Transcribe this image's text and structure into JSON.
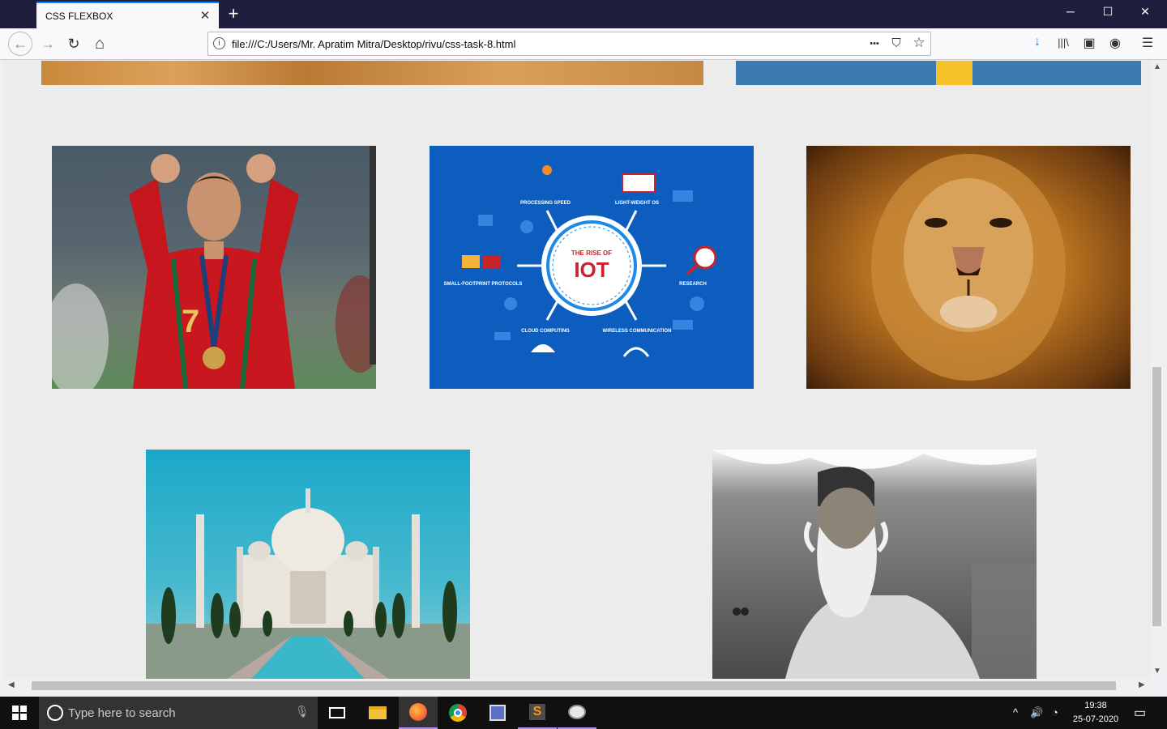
{
  "tab": {
    "title": "CSS FLEXBOX",
    "close": "✕",
    "new_tab": "+"
  },
  "window_controls": {
    "minimize": "─",
    "maximize": "☐",
    "close": "✕"
  },
  "nav": {
    "url": "file:///C:/Users/Mr. Apratim Mitra/Desktop/rivu/css-task-8.html",
    "back": "←",
    "forward": "→",
    "reload": "↻",
    "home": "⌂",
    "page_actions": "•••",
    "pocket": "⛉",
    "star": "☆",
    "download": "↓",
    "library": "|||\\",
    "sidebar": "▣",
    "account": "◉",
    "menu": "☰"
  },
  "gallery": {
    "images": [
      {
        "name": "footballer-photo",
        "alt": "Footballer celebrating"
      },
      {
        "name": "iot-infographic",
        "alt": "The Rise of IOT"
      },
      {
        "name": "lion-photo",
        "alt": "Lion face"
      },
      {
        "name": "taj-mahal-photo",
        "alt": "Taj Mahal"
      },
      {
        "name": "tagore-photo",
        "alt": "Elderly bearded man portrait"
      }
    ],
    "iot": {
      "title_top": "THE RISE OF",
      "title_main": "IOT",
      "labels": [
        "PROCESSING SPEED",
        "LIGHT-WEIGHT OS",
        "SMALL-FOOTPRINT PROTOCOLS",
        "RESEARCH",
        "CLOUD COMPUTING",
        "WIRELESS COMMUNICATION"
      ]
    }
  },
  "taskbar": {
    "search_placeholder": "Type here to search",
    "time": "19:38",
    "date": "25-07-2020"
  },
  "colors": {
    "accent": "#0a84ff",
    "titlebar": "#1f1f3d",
    "iot_blue": "#0d5dbe",
    "iot_red": "#c8242b"
  }
}
